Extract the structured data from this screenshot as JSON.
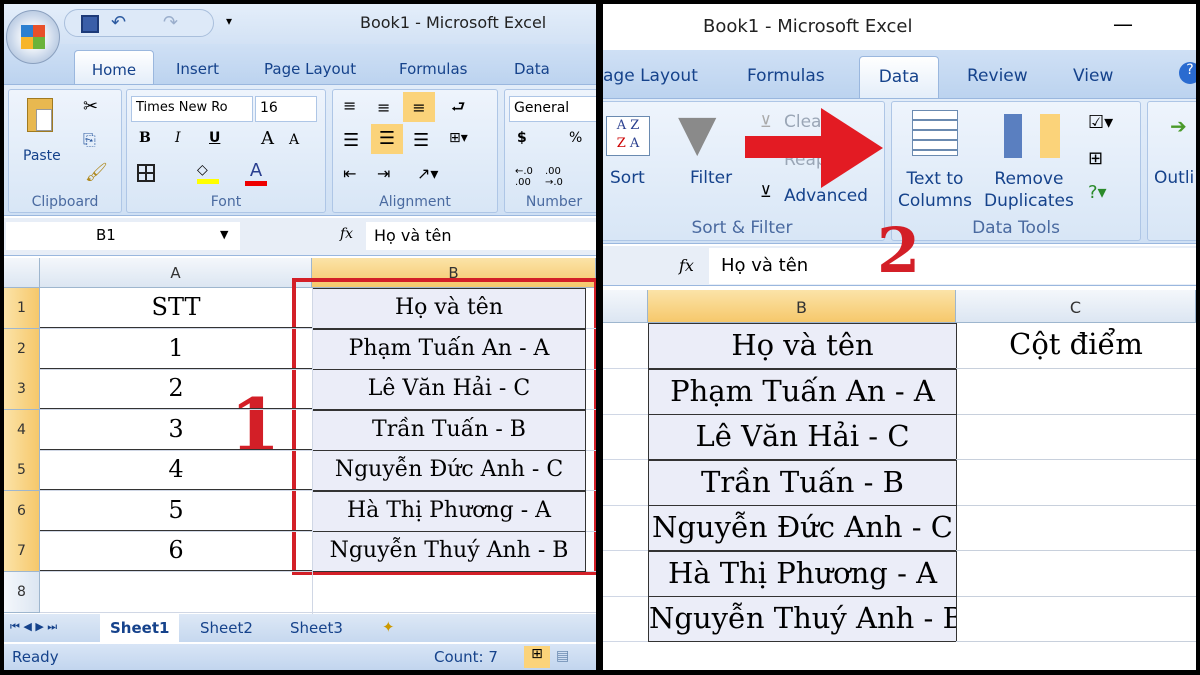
{
  "left": {
    "title": "Book1 - Microsoft Excel",
    "tabs": [
      "Home",
      "Insert",
      "Page Layout",
      "Formulas",
      "Data"
    ],
    "clipboard": {
      "paste": "Paste",
      "label": "Clipboard"
    },
    "font": {
      "name": "Times New Ro",
      "size": "16",
      "bold": "B",
      "italic": "I",
      "underline": "U",
      "label": "Font"
    },
    "alignment": {
      "label": "Alignment"
    },
    "number": {
      "format": "General",
      "currency": "$",
      "percent": "%",
      "label": "Number"
    },
    "name_box": "B1",
    "fx": "fx",
    "formula": "Họ và tên",
    "columns": [
      "A",
      "B"
    ],
    "rows": [
      "1",
      "2",
      "3",
      "4",
      "5",
      "6",
      "7",
      "8"
    ],
    "colA": [
      "STT",
      "1",
      "2",
      "3",
      "4",
      "5",
      "6"
    ],
    "colB": [
      "Họ và tên",
      "Phạm Tuấn An - A",
      "Lê Văn Hải - C",
      "Trần Tuấn - B",
      "Nguyễn Đức Anh - C",
      "Hà Thị Phương - A",
      "Nguyễn Thuý Anh - B"
    ],
    "step": "1",
    "sheets": [
      "Sheet1",
      "Sheet2",
      "Sheet3"
    ],
    "status": "Ready",
    "count": "Count: 7"
  },
  "right": {
    "title": "Book1 - Microsoft Excel",
    "tabs": [
      "age Layout",
      "Formulas",
      "Data",
      "Review",
      "View"
    ],
    "sort": "Sort",
    "filter": "Filter",
    "clear": "Clear",
    "reapply": "Reapply",
    "advanced": "Advanced",
    "sort_filter_label": "Sort & Filter",
    "text_to_columns": [
      "Text to",
      "Columns"
    ],
    "remove_duplicates": [
      "Remove",
      "Duplicates"
    ],
    "data_tools_label": "Data Tools",
    "outline": "Outli",
    "fx": "fx",
    "formula": "Họ và tên",
    "columns": [
      "B",
      "C"
    ],
    "colB": [
      "Họ và tên",
      "Phạm Tuấn An - A",
      "Lê Văn Hải - C",
      "Trần Tuấn - B",
      "Nguyễn Đức Anh - C",
      "Hà Thị Phương - A",
      "Nguyễn Thuý Anh - B"
    ],
    "colC": [
      "Cột điểm"
    ],
    "step": "2"
  },
  "colors": {
    "annotation_red": "#e31b23",
    "selected_header": "#f6c86b",
    "ribbon": "#dbe7f6"
  }
}
